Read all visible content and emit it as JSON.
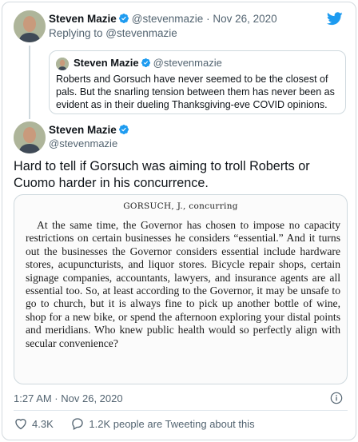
{
  "parent_tweet": {
    "author_name": "Steven Mazie",
    "handle": "@stevenmazie",
    "separator": "·",
    "date": "Nov 26, 2020",
    "replying_to": "Replying to @stevenmazie",
    "quoted": {
      "author_name": "Steven Mazie",
      "handle": "@stevenmazie",
      "text": "Roberts and Gorsuch have never seemed to be the closest of pals. But the snarling tension between them has never been as evident as in their dueling Thanksgiving-eve COVID opinions."
    }
  },
  "main_tweet": {
    "author_name": "Steven Mazie",
    "handle": "@stevenmazie",
    "text": "Hard to tell if Gorsuch was aiming to troll Roberts or Cuomo harder in his concurrence.",
    "image": {
      "heading": "GORSUCH, J., concurring",
      "body": "At the same time, the Governor has chosen to impose no capacity restrictions on certain businesses he considers “essential.” And it turns out the businesses the Governor considers essential include hardware stores, acupuncturists, and liquor stores. Bicycle repair shops, certain signage companies, accountants, lawyers, and insurance agents are all essential too. So, at least according to the Governor, it may be unsafe to go to church, but it is always fine to pick up another bottle of wine, shop for a new bike, or spend the afternoon exploring your distal points and meridians. Who knew public health would so perfectly align with secular convenience?"
    },
    "timestamp": "1:27 AM · Nov 26, 2020",
    "likes": "4.3K",
    "replies_text": "1.2K people are Tweeting about this"
  },
  "colors": {
    "brand": "#1d9bf0",
    "text": "#0f1419",
    "muted": "#536471",
    "border": "#cfd9de"
  },
  "icons": [
    "twitter-bird-icon",
    "verified-badge-icon",
    "info-icon",
    "heart-icon",
    "reply-bubble-icon"
  ]
}
